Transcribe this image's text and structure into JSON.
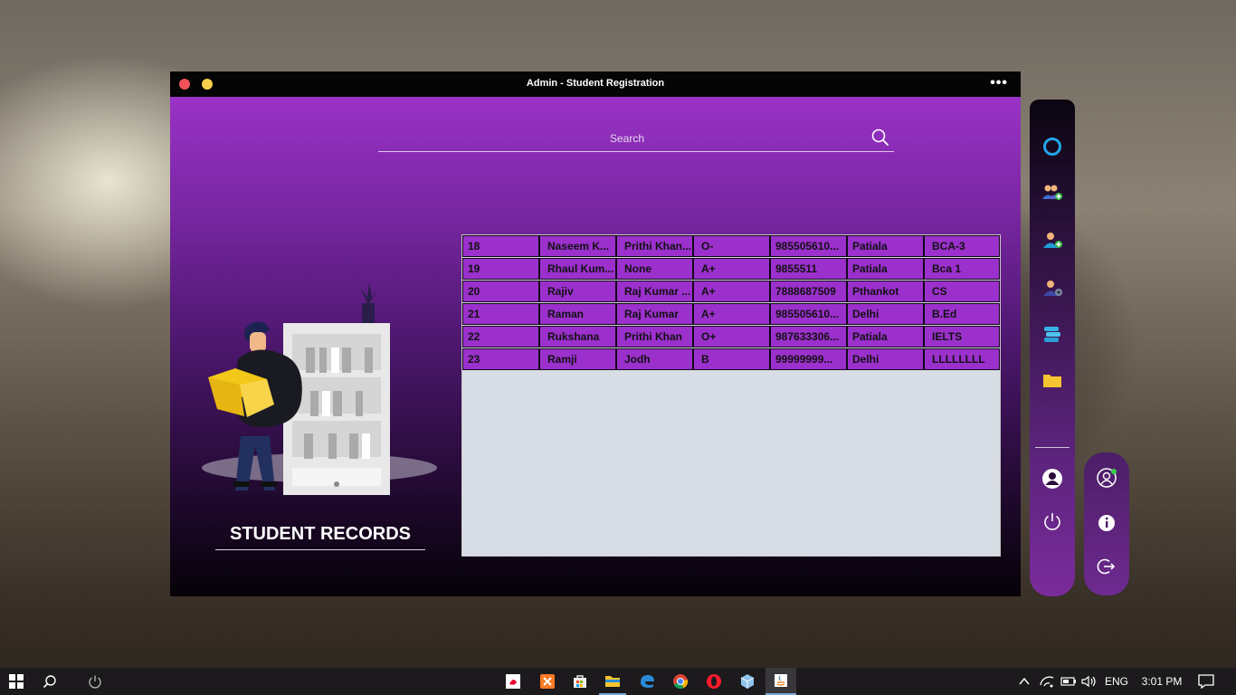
{
  "window": {
    "title": "Admin - Student Registration",
    "more_label": "•••"
  },
  "search": {
    "placeholder": "Search"
  },
  "left_panel": {
    "title": "STUDENT RECORDS"
  },
  "table": {
    "rows": [
      [
        "18",
        "Naseem K...",
        "Prithi Khan...",
        "O-",
        "985505610...",
        "Patiala",
        "BCA-3"
      ],
      [
        "19",
        "Rhaul Kum...",
        "None",
        "A+",
        "9855511",
        "Patiala",
        "Bca 1"
      ],
      [
        "20",
        "Rajiv",
        "Raj Kumar ...",
        "A+",
        "7888687509",
        "Pthankot",
        "CS"
      ],
      [
        "21",
        "Raman",
        "Raj Kumar",
        "A+",
        "985505610...",
        "Delhi",
        "B.Ed"
      ],
      [
        "22",
        "Rukshana",
        "Prithi Khan",
        "O+",
        "987633306...",
        "Patiala",
        "IELTS"
      ],
      [
        "23",
        "Ramji",
        "Jodh",
        "B",
        "99999999...",
        "Delhi",
        "LLLLLLLL"
      ]
    ]
  },
  "sidebar": {
    "items": [
      "cortana-icon",
      "add-group-icon",
      "add-user-icon",
      "user-settings-icon",
      "books-icon",
      "folder-icon",
      "profile-icon",
      "power-icon"
    ],
    "secondary": [
      "user-circle-icon",
      "info-icon",
      "logout-icon"
    ]
  },
  "taskbar": {
    "language": "ENG",
    "time": "3:01 PM",
    "apps": [
      "airtel-icon",
      "xampp-icon",
      "store-icon",
      "file-explorer-icon",
      "edge-icon",
      "chrome-icon",
      "opera-icon",
      "box-icon",
      "java-icon"
    ]
  },
  "colors": {
    "accent": "#9b30cc",
    "table_bg": "#d8dce5"
  }
}
